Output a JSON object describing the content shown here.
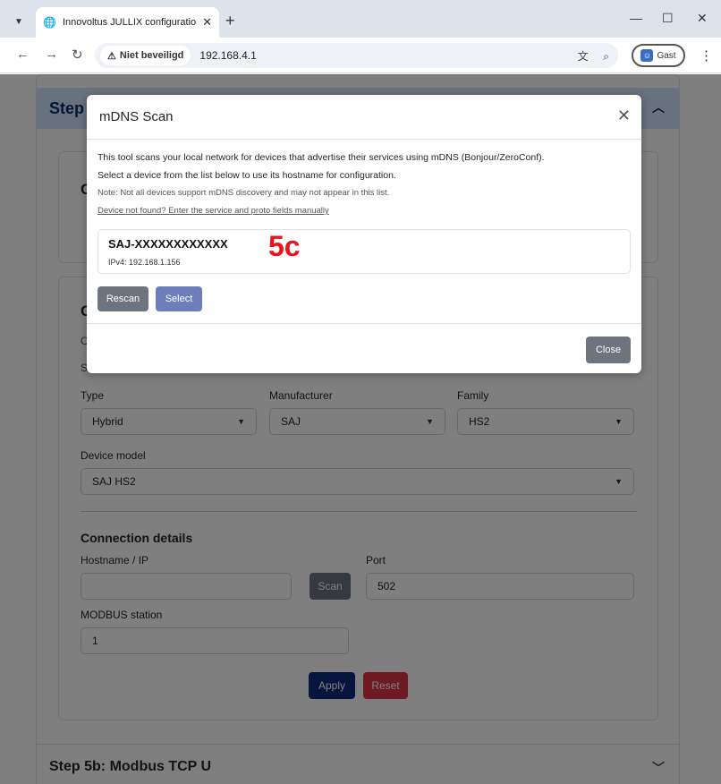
{
  "browser": {
    "tab_title": "Innovoltus JULLIX configuration",
    "security_label": "Niet beveiligd",
    "url": "192.168.4.1",
    "profile_label": "Gast"
  },
  "page": {
    "step_header": "Step",
    "card1_title": "C",
    "card2_title": "C",
    "card2_frag1": "C",
    "card2_frag2": "S",
    "type_label": "Type",
    "type_value": "Hybrid",
    "manufacturer_label": "Manufacturer",
    "manufacturer_value": "SAJ",
    "family_label": "Family",
    "family_value": "HS2",
    "device_model_label": "Device model",
    "device_model_value": "SAJ HS2",
    "connection_title": "Connection details",
    "hostname_label": "Hostname / IP",
    "hostname_value": "",
    "scan_button": "Scan",
    "port_label": "Port",
    "port_value": "502",
    "modbus_label": "MODBUS station",
    "modbus_value": "1",
    "apply_button": "Apply",
    "reset_button": "Reset",
    "step5b_header": "Step 5b: Modbus TCP U"
  },
  "modal": {
    "title": "mDNS Scan",
    "desc_line1": "This tool scans your local network for devices that advertise their services using mDNS (Bonjour/ZeroConf).",
    "desc_line2": "Select a device from the list below to use its hostname for configuration.",
    "note": "Note: Not all devices support mDNS discovery and may not appear in this list.",
    "manual_link": "Device not found? Enter the service and proto fields manually",
    "device_name": "SAJ-XXXXXXXXXXXX",
    "device_ip": "IPv4: 192.168.1.156",
    "annotation": "5c",
    "rescan_button": "Rescan",
    "select_button": "Select",
    "close_button": "Close"
  },
  "colors": {
    "accordion_active_bg": "#cfe2ff",
    "apply_button": "#0d2a7a",
    "reset_button": "#dc3545",
    "annotation": "#e8141b"
  }
}
